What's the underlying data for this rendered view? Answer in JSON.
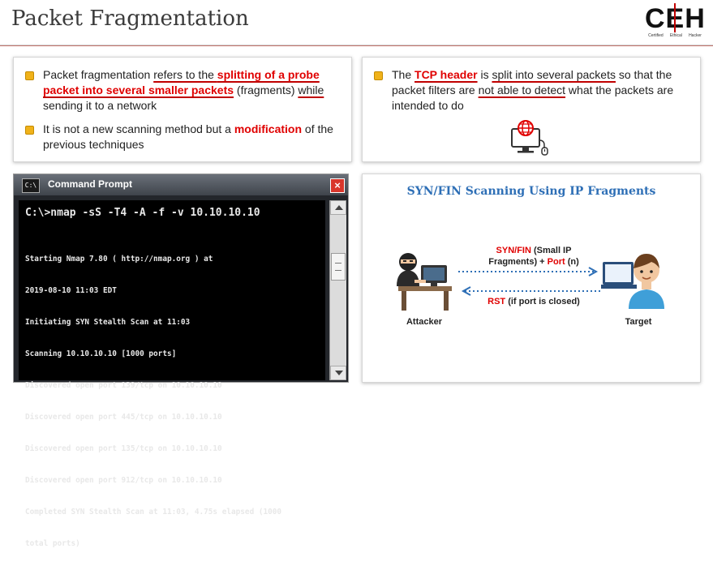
{
  "header": {
    "title": "Packet Fragmentation",
    "logo_text": "CEH",
    "logo_sub": [
      "Certified",
      "Ethical",
      "Hacker"
    ]
  },
  "card_left": {
    "bullet1": {
      "t1": "Packet fragmentation ",
      "t2": "refers to the ",
      "t3": "splitting of a probe packet into several smaller packets",
      "t4": " (fragments) ",
      "t5": "while",
      "t6": " sending it to a network"
    },
    "bullet2": {
      "t1": "It is not a new scanning method but a ",
      "t2": "modification",
      "t3": " of the previous techniques"
    }
  },
  "card_right": {
    "t1": "The ",
    "t2": "TCP header",
    "t3": " is ",
    "t4": "split into several packets",
    "t5": " so that the packet filters are ",
    "t6": "not able to detect",
    "t7": " what the packets are intended to do",
    "icon": "network-monitor-icon"
  },
  "cmd": {
    "title": "Command Prompt",
    "icon_text": "C:\\",
    "command": "C:\\>nmap -sS -T4 -A -f -v 10.10.10.10",
    "output": [
      "Starting Nmap 7.80 ( http://nmap.org ) at",
      "2019-08-10 11:03 EDT",
      "Initiating SYN Stealth Scan at 11:03",
      "Scanning 10.10.10.10 [1000 ports]",
      "Discovered open port 139/tcp on 10.10.10.10",
      "Discovered open port 445/tcp on 10.10.10.10",
      "Discovered open port 135/tcp on 10.10.10.10",
      "Discovered open port 912/tcp on 10.10.10.10",
      "Completed SYN Stealth Scan at 11:03, 4.75s elapsed (1000",
      "total ports)"
    ]
  },
  "diagram": {
    "title": "SYN/FIN Scanning Using IP Fragments",
    "arrow_top_red": "SYN/FIN",
    "arrow_top_black1": " (Small IP",
    "arrow_top_black2": "Fragments) + ",
    "arrow_top_red2": "Port",
    "arrow_top_black3": " (n)",
    "arrow_bottom_red": "RST",
    "arrow_bottom_black": " (if port is closed)",
    "attacker_label": "Attacker",
    "target_label": "Target",
    "colors": {
      "arrow": "#2e6fb6",
      "accent": "#e00000"
    }
  }
}
